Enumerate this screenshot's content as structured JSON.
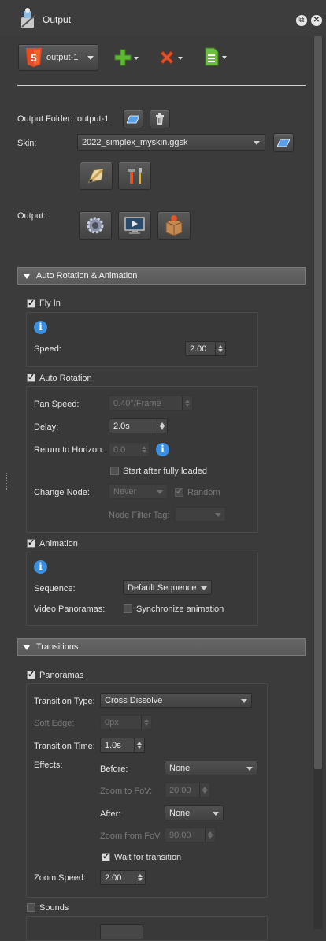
{
  "window": {
    "title": "Output"
  },
  "toolbar": {
    "output_select": "output-1"
  },
  "output_folder": {
    "label": "Output Folder:",
    "value": "output-1"
  },
  "skin": {
    "label": "Skin:",
    "value": "2022_simplex_myskin.ggsk"
  },
  "output": {
    "label": "Output:"
  },
  "auto_rotation_section": {
    "title": "Auto Rotation & Animation"
  },
  "fly_in": {
    "label": "Fly In",
    "speed_label": "Speed:",
    "speed_value": "2.00"
  },
  "auto_rotation": {
    "label": "Auto Rotation",
    "pan_speed_label": "Pan Speed:",
    "pan_speed_value": "0.40°/Frame",
    "delay_label": "Delay:",
    "delay_value": "2.0s",
    "return_label": "Return to Horizon:",
    "return_value": "0.0",
    "start_after_label": "Start after fully loaded",
    "change_node_label": "Change Node:",
    "change_node_value": "Never",
    "random_label": "Random",
    "node_filter_label": "Node Filter Tag:"
  },
  "animation": {
    "label": "Animation",
    "sequence_label": "Sequence:",
    "sequence_value": "Default Sequence",
    "video_label": "Video Panoramas:",
    "sync_label": "Synchronize animation"
  },
  "transitions_section": {
    "title": "Transitions"
  },
  "panoramas": {
    "label": "Panoramas",
    "type_label": "Transition Type:",
    "type_value": "Cross Dissolve",
    "soft_edge_label": "Soft Edge:",
    "soft_edge_value": "0px",
    "time_label": "Transition Time:",
    "time_value": "1.0s",
    "effects_label": "Effects:",
    "before_label": "Before:",
    "before_value": "None",
    "zoom_to_label": "Zoom to FoV:",
    "zoom_to_value": "20.00",
    "after_label": "After:",
    "after_value": "None",
    "zoom_from_label": "Zoom from FoV:",
    "zoom_from_value": "90.00",
    "wait_label": "Wait for transition",
    "zoom_speed_label": "Zoom Speed:",
    "zoom_speed_value": "2.00"
  },
  "sounds": {
    "label": "Sounds"
  },
  "colors": {
    "accent_blue": "#3a8fe0",
    "add_green": "#5fb832",
    "remove_red": "#e0542a",
    "html5_orange": "#e44d26"
  }
}
